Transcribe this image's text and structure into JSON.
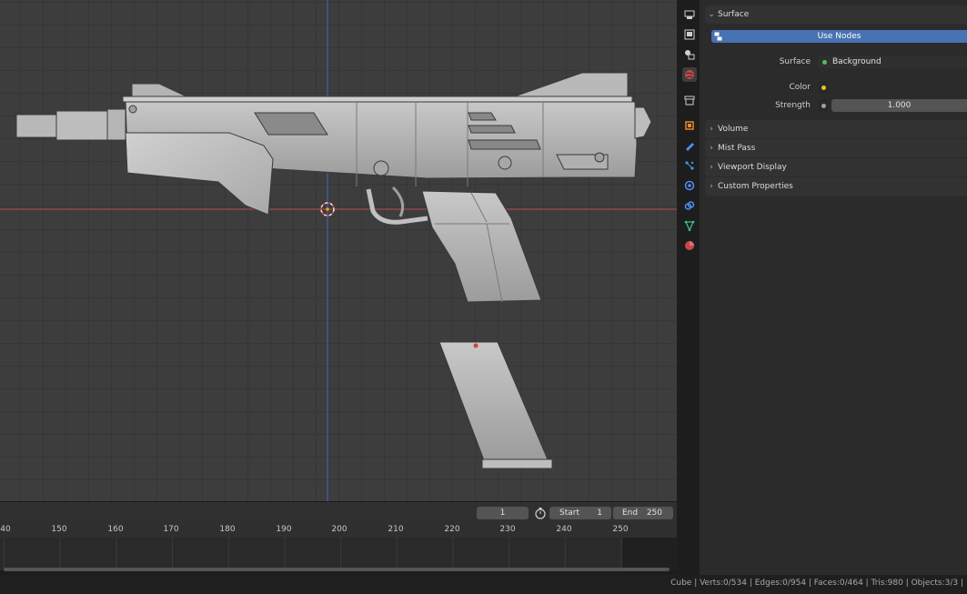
{
  "colors": {
    "accent": "#4772b3",
    "x_axis": "#c8474e",
    "y_axis": "#3f6fc0",
    "socket_green": "#5cb85c",
    "socket_yellow": "#e5c620",
    "socket_grey": "#a0a0a0"
  },
  "tabs": [
    {
      "name": "render-tab-icon",
      "active": false
    },
    {
      "name": "output-tab-icon",
      "active": false
    },
    {
      "name": "view-layer-tab-icon",
      "active": false
    },
    {
      "name": "world-tab-icon",
      "active": true
    },
    {
      "name": "collection-tab-icon",
      "active": false
    },
    {
      "name": "object-tab-icon",
      "active": false
    },
    {
      "name": "modifier-tab-icon",
      "active": false
    },
    {
      "name": "particles-tab-icon",
      "active": false
    },
    {
      "name": "physics-tab-icon",
      "active": false
    },
    {
      "name": "constraints-tab-icon",
      "active": false
    },
    {
      "name": "data-tab-icon",
      "active": false
    },
    {
      "name": "material-tab-icon",
      "active": false
    }
  ],
  "properties": {
    "surface_header": "Surface",
    "use_nodes_label": "Use Nodes",
    "surface_label": "Surface",
    "surface_value": "Background",
    "color_label": "Color",
    "strength_label": "Strength",
    "strength_value": "1.000",
    "volume_header": "Volume",
    "mist_header": "Mist Pass",
    "viewport_display_header": "Viewport Display",
    "custom_props_header": "Custom Properties"
  },
  "timeline": {
    "current_frame": "1",
    "start_label": "Start",
    "start_value": "1",
    "end_label": "End",
    "end_value": "250",
    "ticks": [
      "40",
      "150",
      "160",
      "170",
      "180",
      "190",
      "200",
      "210",
      "220",
      "230",
      "240",
      "250"
    ]
  },
  "status": {
    "text": "Cube | Verts:0/534 | Edges:0/954 | Faces:0/464 | Tris:980 | Objects:3/3 |"
  }
}
